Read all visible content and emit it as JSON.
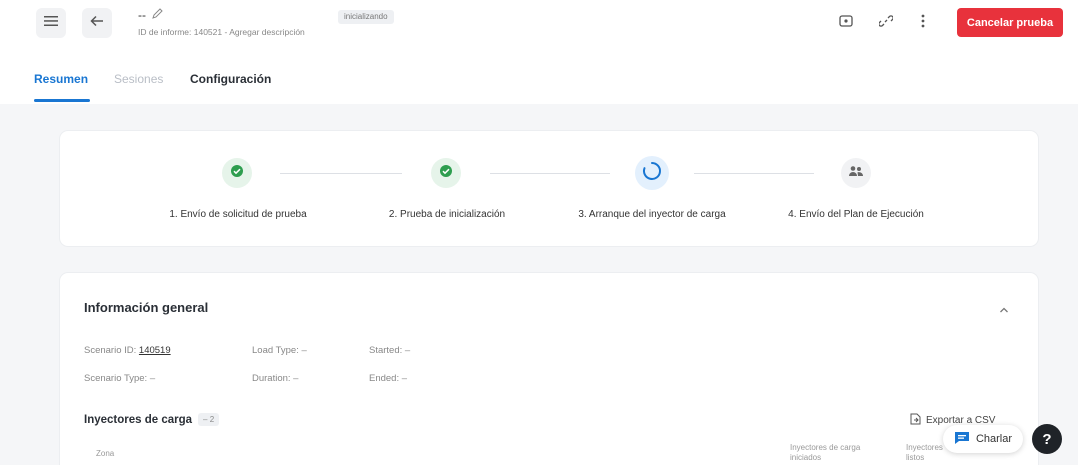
{
  "header": {
    "title": "--",
    "subtitle": "ID de informe: 140521 - Agregar descripción",
    "status": "inicializando",
    "cancel_label": "Cancelar prueba"
  },
  "tabs": [
    {
      "label": "Resumen"
    },
    {
      "label": "Sesiones"
    },
    {
      "label": "Configuración"
    }
  ],
  "steps": [
    {
      "label": "1. Envío de solicitud de prueba",
      "state": "done"
    },
    {
      "label": "2. Prueba de inicialización",
      "state": "done"
    },
    {
      "label": "3. Arranque del inyector de carga",
      "state": "active"
    },
    {
      "label": "4. Envío del Plan de Ejecución",
      "state": "pending"
    }
  ],
  "info": {
    "title": "Información general",
    "scenario_id_label": "Scenario ID:",
    "scenario_id_value": "140519",
    "scenario_type": "Scenario Type: –",
    "load_type": "Load Type: –",
    "duration": "Duration: –",
    "started": "Started: –",
    "ended": "Ended: –"
  },
  "injectors": {
    "title": "Inyectores de carga",
    "count": "– 2",
    "export_label": "Exportar a CSV",
    "columns": [
      "Zona",
      "Inyectores de carga iniciados",
      "Inyectores listos"
    ]
  },
  "chat_label": "Charlar",
  "colors": {
    "accent": "#1976d2",
    "danger": "#e8323c",
    "success": "#2e9e4f"
  }
}
